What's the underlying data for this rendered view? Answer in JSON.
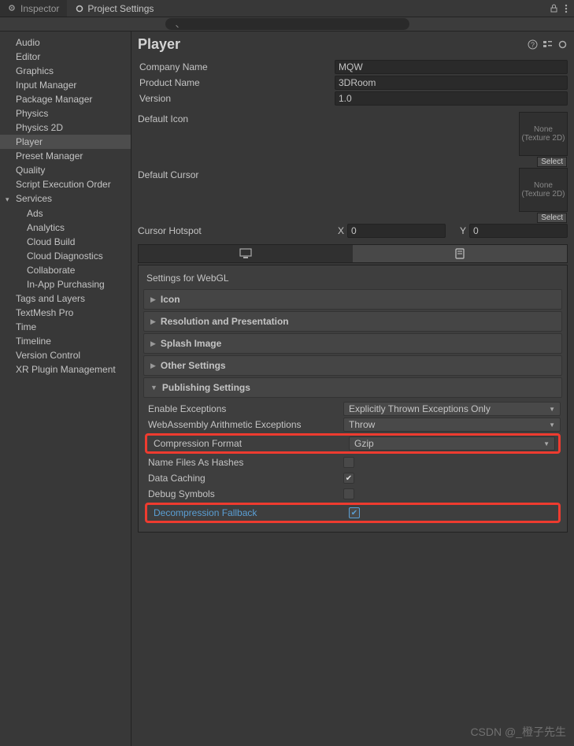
{
  "tabs": {
    "inspector": "Inspector",
    "projectSettings": "Project Settings"
  },
  "sidebar": {
    "items": [
      "Audio",
      "Editor",
      "Graphics",
      "Input Manager",
      "Package Manager",
      "Physics",
      "Physics 2D",
      "Player",
      "Preset Manager",
      "Quality",
      "Script Execution Order",
      "Services",
      "Tags and Layers",
      "TextMesh Pro",
      "Time",
      "Timeline",
      "Version Control",
      "XR Plugin Management"
    ],
    "serviceChildren": [
      "Ads",
      "Analytics",
      "Cloud Build",
      "Cloud Diagnostics",
      "Collaborate",
      "In-App Purchasing"
    ]
  },
  "page": {
    "title": "Player"
  },
  "fields": {
    "companyName": {
      "label": "Company Name",
      "value": "MQW"
    },
    "productName": {
      "label": "Product Name",
      "value": "3DRoom"
    },
    "version": {
      "label": "Version",
      "value": "1.0"
    },
    "defaultIcon": {
      "label": "Default Icon",
      "none": "None",
      "type": "(Texture 2D)",
      "select": "Select"
    },
    "defaultCursor": {
      "label": "Default Cursor",
      "none": "None",
      "type": "(Texture 2D)",
      "select": "Select"
    },
    "cursorHotspot": {
      "label": "Cursor Hotspot",
      "x": "X",
      "xval": "0",
      "y": "Y",
      "yval": "0"
    }
  },
  "settings": {
    "title": "Settings for WebGL",
    "folds": [
      "Icon",
      "Resolution and Presentation",
      "Splash Image",
      "Other Settings",
      "Publishing Settings"
    ]
  },
  "publishing": {
    "enableExceptions": {
      "label": "Enable Exceptions",
      "value": "Explicitly Thrown Exceptions Only"
    },
    "wasmArith": {
      "label": "WebAssembly Arithmetic Exceptions",
      "value": "Throw"
    },
    "compression": {
      "label": "Compression Format",
      "value": "Gzip"
    },
    "nameHashes": {
      "label": "Name Files As Hashes",
      "checked": false
    },
    "dataCaching": {
      "label": "Data Caching",
      "checked": true
    },
    "debugSymbols": {
      "label": "Debug Symbols",
      "checked": false
    },
    "decompFallback": {
      "label": "Decompression Fallback",
      "checked": true
    }
  },
  "watermark": "CSDN @_橙子先生"
}
